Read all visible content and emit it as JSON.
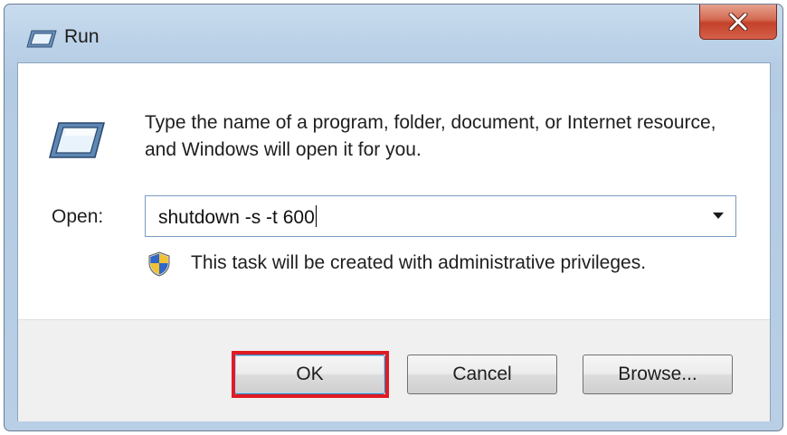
{
  "window": {
    "title": "Run"
  },
  "dialog": {
    "description": "Type the name of a program, folder, document, or Internet resource, and Windows will open it for you.",
    "open_label": "Open:",
    "command_value": "shutdown -s -t 600",
    "admin_note": "This task will be created with administrative privileges."
  },
  "buttons": {
    "ok_label": "OK",
    "cancel_label": "Cancel",
    "browse_label": "Browse..."
  },
  "icons": {
    "title": "run-icon",
    "main": "run-icon",
    "shield": "uac-shield-icon",
    "close": "close-x-icon",
    "dropdown": "chevron-down-icon"
  },
  "colors": {
    "highlight": "#e01b24",
    "close_button": "#c4412a"
  }
}
